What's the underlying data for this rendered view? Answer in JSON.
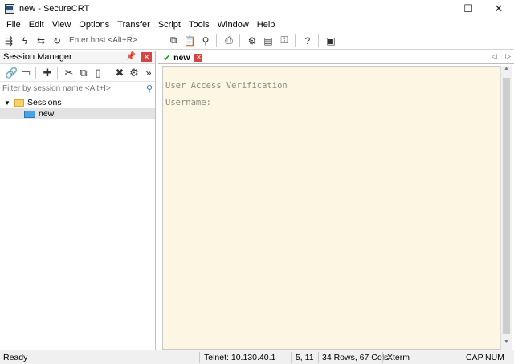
{
  "window": {
    "title": "new - SecureCRT",
    "minimize": "—",
    "maximize": "☐",
    "close": "✕"
  },
  "menu": [
    "File",
    "Edit",
    "View",
    "Options",
    "Transfer",
    "Script",
    "Tools",
    "Window",
    "Help"
  ],
  "toolbar": {
    "quick_connect_placeholder": "Enter host <Alt+R>"
  },
  "session_manager": {
    "title": "Session Manager",
    "filter_placeholder": "Filter by session name <Alt+I>",
    "tree": {
      "folder": "Sessions",
      "session": "new"
    }
  },
  "tab": {
    "label": "new"
  },
  "terminal": {
    "lines": [
      "User Access Verification",
      "Username:"
    ]
  },
  "status": {
    "ready": "Ready",
    "connection": "Telnet: 10.130.40.1",
    "cursor": "5,  11",
    "size": "34 Rows, 67 Cols",
    "terminal_type": "Xterm",
    "caps": "CAP",
    "num": "NUM"
  }
}
